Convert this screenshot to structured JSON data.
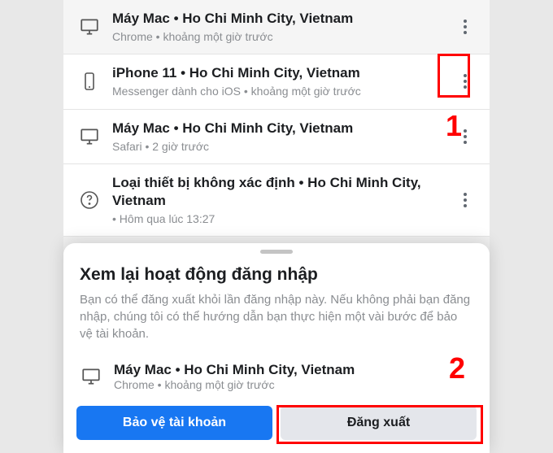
{
  "devices": [
    {
      "title": "Máy Mac • Ho Chi Minh City, Vietnam",
      "subtitle": "Chrome • khoảng một giờ trước",
      "icon": "desktop"
    },
    {
      "title": "iPhone 11 • Ho Chi Minh City, Vietnam",
      "subtitle": "Messenger dành cho iOS • khoảng một giờ trước",
      "icon": "phone"
    },
    {
      "title": "Máy Mac • Ho Chi Minh City, Vietnam",
      "subtitle": "Safari • 2 giờ trước",
      "icon": "desktop"
    },
    {
      "title": "Loại thiết bị không xác định • Ho Chi Minh City, Vietnam",
      "subtitle": " • Hôm qua lúc 13:27",
      "icon": "unknown"
    }
  ],
  "sheet": {
    "title": "Xem lại hoạt động đăng nhập",
    "description": "Bạn có thể đăng xuất khỏi lần đăng nhập này. Nếu không phải bạn đăng nhập, chúng tôi có thể hướng dẫn bạn thực hiện một vài bước để bảo vệ tài khoản.",
    "device_title": "Máy Mac • Ho Chi Minh City, Vietnam",
    "device_subtitle": "Chrome • khoảng một giờ trước",
    "protect_label": "Bảo vệ tài khoản",
    "logout_label": "Đăng xuất"
  },
  "annotations": {
    "label1": "1",
    "label2": "2"
  }
}
